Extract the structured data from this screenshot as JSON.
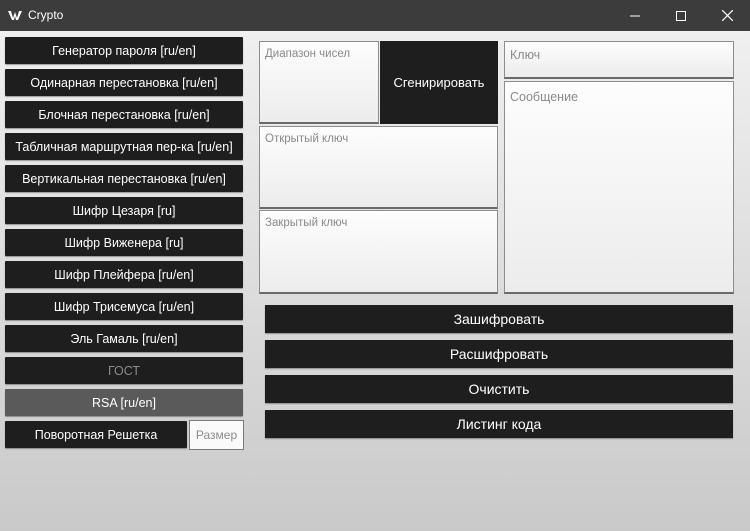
{
  "window": {
    "title": "Crypto"
  },
  "sidebar": {
    "items": [
      {
        "label": "Генератор пароля [ru/en]"
      },
      {
        "label": "Одинарная перестановка [ru/en]"
      },
      {
        "label": "Блочная перестановка [ru/en]"
      },
      {
        "label": "Табличная маршрутная пер-ка [ru/en]"
      },
      {
        "label": "Вертикальная перестановка [ru/en]"
      },
      {
        "label": "Шифр Цезаря [ru]"
      },
      {
        "label": "Шифр Виженера [ru]"
      },
      {
        "label": "Шифр Плейфера [ru/en]"
      },
      {
        "label": "Шифр Трисемуса [ru/en]"
      },
      {
        "label": "Эль Гамаль [ru/en]"
      },
      {
        "label": "ГОСТ",
        "state": "disabled"
      },
      {
        "label": "RSA [ru/en]",
        "state": "selected"
      },
      {
        "label": "Поворотная Решетка"
      }
    ],
    "size_input": {
      "placeholder": "Размер"
    }
  },
  "params": {
    "range_placeholder": "Диапазон чисел",
    "generate_label": "Сгенирировать",
    "public_key_placeholder": "Открытый ключ",
    "private_key_placeholder": "Закрытый ключ",
    "key_placeholder": "Ключ",
    "message_placeholder": "Сообщение"
  },
  "actions": {
    "encrypt": "Зашифровать",
    "decrypt": "Расшифровать",
    "clear": "Очистить",
    "listing": "Листинг кода"
  },
  "colors": {
    "titlebar": "#3c3c3c",
    "button_bg": "#1e1e1e",
    "button_selected": "#5a5a5a",
    "button_disabled_text": "#8a8a8a"
  }
}
